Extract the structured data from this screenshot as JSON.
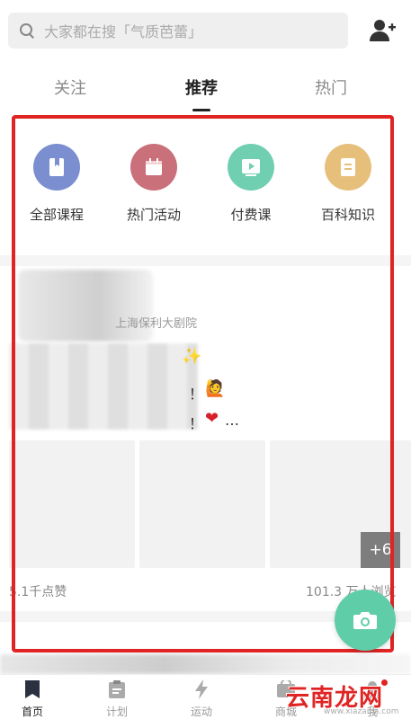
{
  "search": {
    "placeholder": "大家都在搜「气质芭蕾」"
  },
  "tabs": [
    {
      "label": "关注"
    },
    {
      "label": "推荐"
    },
    {
      "label": "热门"
    }
  ],
  "categories": [
    {
      "label": "全部课程",
      "color": "#7b8fd0",
      "icon": "book-icon"
    },
    {
      "label": "热门活动",
      "color": "#c9707a",
      "icon": "calendar-icon"
    },
    {
      "label": "付费课",
      "color": "#6fcfb0",
      "icon": "video-icon"
    },
    {
      "label": "百科知识",
      "color": "#e6c07a",
      "icon": "document-icon"
    }
  ],
  "post": {
    "location": "上海保利大剧院",
    "text_tail_1": "！",
    "text_tail_2": "！",
    "text_tail_3": "…",
    "more_count": "+6",
    "likes": "5.1千点赞",
    "views": "101.3 万人浏览"
  },
  "nav": [
    {
      "label": "首页",
      "icon": "home-bookmark-icon",
      "active": true
    },
    {
      "label": "计划",
      "icon": "clipboard-icon",
      "active": false
    },
    {
      "label": "运动",
      "icon": "lightning-icon",
      "active": false
    },
    {
      "label": "商城",
      "icon": "shop-icon",
      "active": false
    },
    {
      "label": "我",
      "icon": "profile-icon",
      "active": false
    }
  ],
  "watermark": {
    "text": "云南龙网",
    "sub": "www.xiazaiba.com"
  },
  "colors": {
    "accent_red": "#e02424",
    "fab": "#5fcda7"
  }
}
